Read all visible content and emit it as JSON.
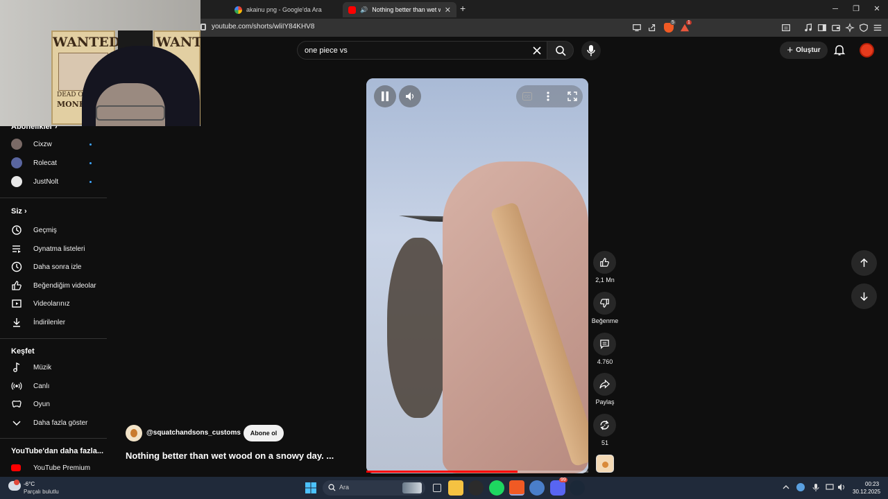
{
  "browser": {
    "tabs": [
      {
        "title": "akainu png - Google'da Ara",
        "active": false
      },
      {
        "title": "Nothing better than wet woo",
        "active": true
      }
    ],
    "url": "youtube.com/shorts/wliIY84KHV8",
    "badges": {
      "brave_shields": "5",
      "rewards": "1"
    }
  },
  "youtube": {
    "search_value": "one piece vs",
    "create_label": "Oluştur"
  },
  "sidebar": {
    "subs_heading": "Abonelikler",
    "channels": [
      {
        "name": "Cixzw",
        "color": "#7a6a66"
      },
      {
        "name": "Rolecat",
        "color": "#5a66a0"
      },
      {
        "name": "JustNolt",
        "color": "#e8e8e8"
      }
    ],
    "you_heading": "Siz",
    "you_items": [
      "Geçmiş",
      "Oynatma listeleri",
      "Daha sonra izle",
      "Beğendiğim videolar",
      "Videolarınız",
      "İndirilenler"
    ],
    "explore_heading": "Keşfet",
    "explore_items": [
      "Müzik",
      "Canlı",
      "Oyun",
      "Daha fazla göster"
    ],
    "more_heading": "YouTube'dan daha fazla...",
    "more_items": [
      "YouTube Premium"
    ]
  },
  "short": {
    "channel": "@squatchandsons_customs",
    "subscribe_label": "Abone ol",
    "title": "Nothing better than wet wood on a snowy day. ...",
    "likes": "2,1 Mn",
    "dislike_label": "Beğenme",
    "comments": "4.760",
    "share_label": "Paylaş",
    "remix_count": "51",
    "progress": 0.68
  },
  "webcam": {
    "poster_left": "WANTED",
    "poster_right": "WANT",
    "poster_sub": "DEAD OR A",
    "poster_name": "MONKEY-D"
  },
  "taskbar": {
    "weather_temp": "-6°C",
    "weather_desc": "Parçalı bulutlu",
    "search_label": "Ara",
    "time": "00:23",
    "date": "30.12.2025",
    "discord_badge": "99"
  },
  "colors": {
    "accent": "#ff0000",
    "link": "#3ea6ff",
    "bg": "#0f0f0f"
  }
}
